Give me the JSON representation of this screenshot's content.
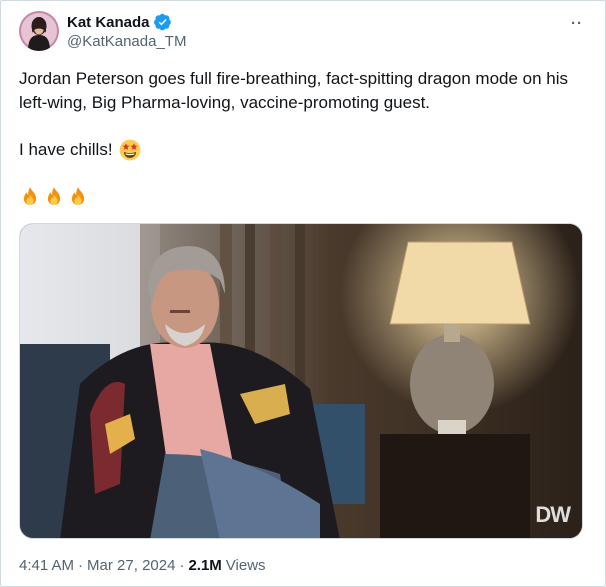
{
  "author": {
    "display_name": "Kat Kanada",
    "handle": "@KatKanada_TM",
    "verified": true,
    "avatar_icon": "avatar-photo",
    "verified_color": "#1d9bf0"
  },
  "more_label": "··",
  "tweet": {
    "text": "Jordan Peterson goes full fire-breathing, fact-spitting dragon mode on his left-wing, Big Pharma-loving, vaccine-promoting guest.",
    "line2": "I have chills!",
    "line2_emoji": "star-struck-emoji",
    "fire_emojis": [
      "fire-emoji",
      "fire-emoji",
      "fire-emoji"
    ]
  },
  "media": {
    "watermark": "DW"
  },
  "meta": {
    "time": "4:41 AM",
    "separator": "·",
    "date": "Mar 27, 2024",
    "separator2": "·",
    "views_count": "2.1M",
    "views_label": "Views"
  }
}
